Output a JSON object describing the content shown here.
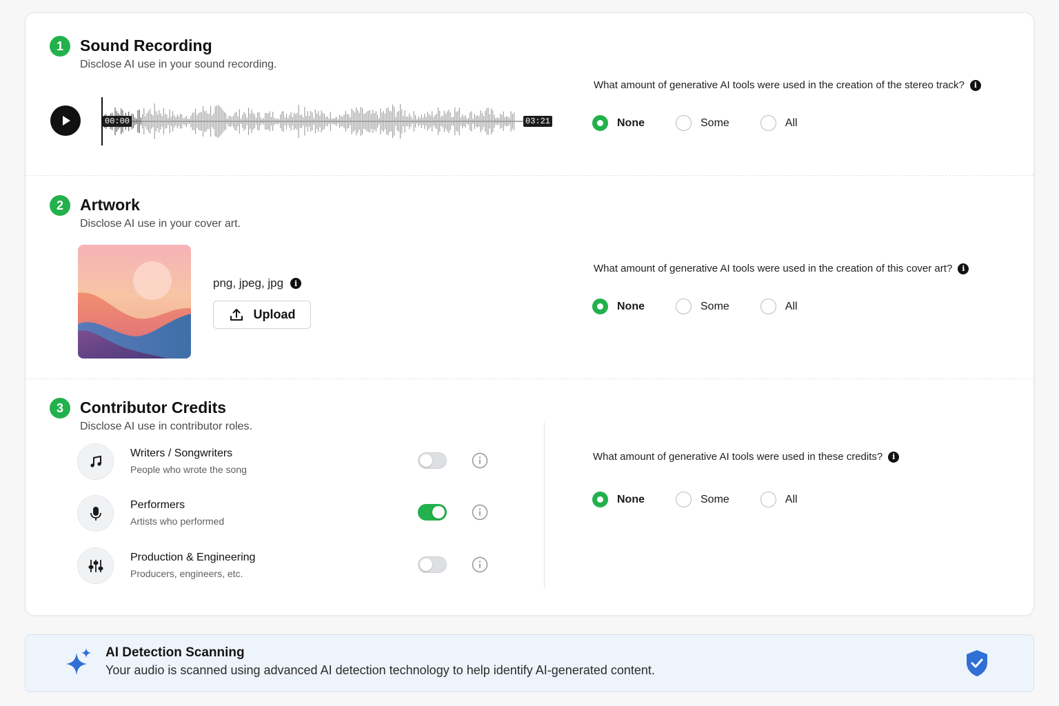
{
  "sections": {
    "recording": {
      "step": "1",
      "title": "Sound Recording",
      "subtitle": "Disclose AI use in your sound recording.",
      "player": {
        "start_time": "00:00",
        "end_time": "03:21"
      },
      "question": "What amount of generative AI tools were used in the creation of the stereo track?",
      "options": [
        "None",
        "Some",
        "All"
      ],
      "selected": "None"
    },
    "artwork": {
      "step": "2",
      "title": "Artwork",
      "subtitle": "Disclose AI use in your cover art.",
      "formats": "png, jpeg, jpg",
      "upload_label": "Upload",
      "question": "What amount of generative AI tools were used in the creation of this cover art?",
      "options": [
        "None",
        "Some",
        "All"
      ],
      "selected": "None"
    },
    "credits": {
      "step": "3",
      "title": "Contributor Credits",
      "subtitle": "Disclose AI use in contributor roles.",
      "roles": [
        {
          "name": "Writers / Songwriters",
          "description": "People who wrote the song",
          "icon": "music-note-icon",
          "enabled": false
        },
        {
          "name": "Performers",
          "description": "Artists who performed",
          "icon": "microphone-icon",
          "enabled": true
        },
        {
          "name": "Production & Engineering",
          "description": "Producers, engineers, etc.",
          "icon": "sliders-icon",
          "enabled": false
        }
      ],
      "question": "What amount of generative AI tools were used in these credits?",
      "options": [
        "None",
        "Some",
        "All"
      ],
      "selected": "None"
    }
  },
  "banner": {
    "title": "AI Detection Scanning",
    "text": "Your audio is scanned using advanced AI detection technology to help identify AI-generated content.",
    "icons": [
      "sparkle-icon",
      "shield-check-icon"
    ]
  },
  "colors": {
    "accent": "#22b14c",
    "banner_bg": "#eef4fb",
    "shield": "#2f6fd6"
  }
}
